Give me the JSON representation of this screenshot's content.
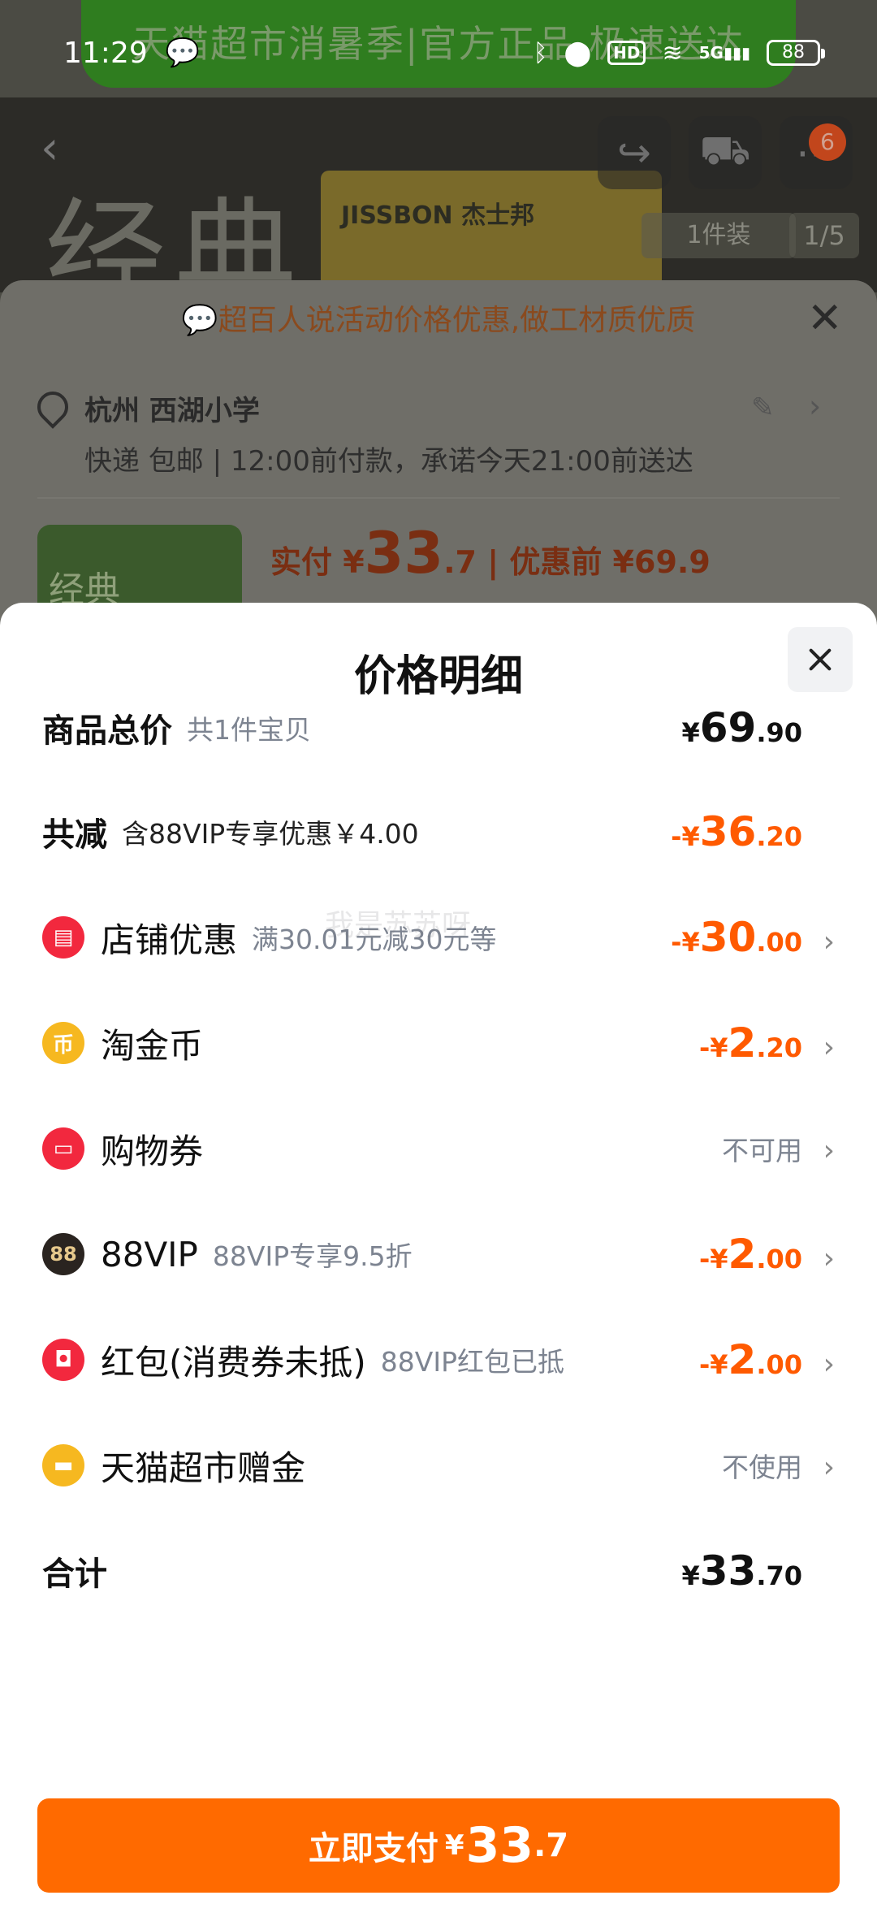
{
  "status_bar": {
    "time": "11:29",
    "network": "5G",
    "hd_label": "HD",
    "battery": "88"
  },
  "background": {
    "banner_text": "天猫超市消暑季|官方正品 极速送达",
    "hero_text": "经典",
    "brand": "JISSBON 杰士邦",
    "pack_label": "1件装",
    "image_index": "1/5",
    "cart_badge": "6",
    "tip": "超百人说活动价格优惠,做工材质优质",
    "address": "杭州 西湖小学",
    "delivery": "快递 包邮 | 12:00前付款，承诺今天21:00前送达",
    "paid_label": "实付 ¥",
    "paid_int": "33",
    "paid_dec": ".7",
    "before_discount": "| 优惠前 ¥69.9",
    "thumb_text": "经典"
  },
  "modal": {
    "title": "价格明细",
    "rows": {
      "total_goods": {
        "label": "商品总价",
        "sub": "共1件宝贝",
        "currency": "¥",
        "int": "69",
        "dec": ".90"
      },
      "total_discount": {
        "label": "共减",
        "sub": "含88VIP专享优惠￥4.00",
        "currency": "-¥",
        "int": "36",
        "dec": ".20"
      },
      "shop_discount": {
        "icon": "store-icon",
        "label": "店铺优惠",
        "sub": "满30.01元减30元等",
        "currency": "-¥",
        "int": "30",
        "dec": ".00"
      },
      "tao_coins": {
        "icon": "coin-icon",
        "label": "淘金币",
        "currency": "-¥",
        "int": "2",
        "dec": ".20"
      },
      "shopping_voucher": {
        "icon": "ticket-icon",
        "label": "购物券",
        "status": "不可用"
      },
      "vip88": {
        "icon": "vip88-icon",
        "icon_text": "88",
        "label": "88VIP",
        "sub": "88VIP专享9.5折",
        "currency": "-¥",
        "int": "2",
        "dec": ".00"
      },
      "red_packet": {
        "icon": "red-packet-icon",
        "label": "红包(消费券未抵)",
        "sub": "88VIP红包已抵",
        "currency": "-¥",
        "int": "2",
        "dec": ".00"
      },
      "tmall_bonus": {
        "icon": "wallet-icon",
        "label": "天猫超市赠金",
        "status": "不使用"
      },
      "sum": {
        "label": "合计",
        "currency": "¥",
        "int": "33",
        "dec": ".70"
      }
    },
    "watermark": "我是苏苏呀",
    "pay_button": {
      "label": "立即支付",
      "currency": "¥",
      "int": "33",
      "dec": ".7"
    }
  },
  "colors": {
    "accent_orange": "#ff6a00",
    "discount_text": "#ff5a00",
    "icon_red": "#f2283e",
    "icon_gold": "#f6b820"
  }
}
